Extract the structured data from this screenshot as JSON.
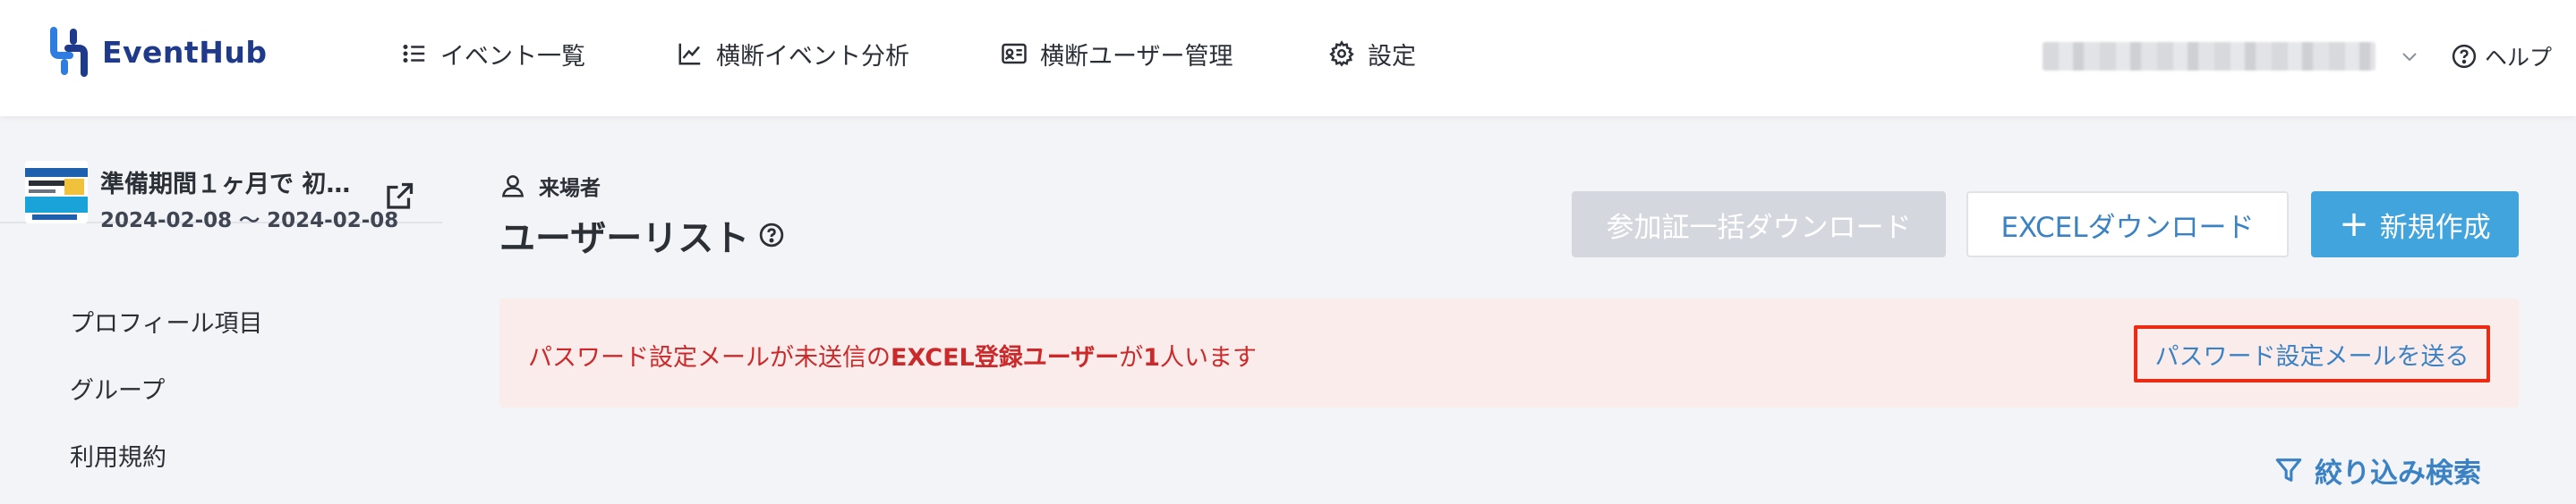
{
  "app": {
    "name": "EventHub",
    "brand_color": "#1f3a8a",
    "accent_color": "#42a4dd"
  },
  "header": {
    "nav": [
      {
        "label": "イベント一覧",
        "icon": "list-icon"
      },
      {
        "label": "横断イベント分析",
        "icon": "chart-line-icon"
      },
      {
        "label": "横断ユーザー管理",
        "icon": "id-card-icon"
      },
      {
        "label": "設定",
        "icon": "gear-icon"
      }
    ],
    "help_label": "ヘルプ"
  },
  "sidebar": {
    "event": {
      "title": "準備期間１ヶ月で 初…",
      "date_range": "2024-02-08 〜 2024-02-08"
    },
    "items": [
      {
        "label": "プロフィール項目"
      },
      {
        "label": "グループ"
      },
      {
        "label": "利用規約"
      }
    ]
  },
  "main": {
    "section_label": "来場者",
    "page_title": "ユーザーリスト",
    "buttons": {
      "bulk_download": "参加証一括ダウンロード",
      "excel_download": "EXCELダウンロード",
      "create_new": "新規作成",
      "create_plus": "+"
    },
    "alert": {
      "prefix": "パスワード設定メールが未送信の",
      "emphasis": "EXCEL登録ユーザー",
      "middle": "が",
      "count": "1",
      "suffix": "人います",
      "action": "パスワード設定メールを送る",
      "text_color": "#cc2a2a",
      "bg_color": "#fbecec",
      "highlight_color": "#ec2b14"
    },
    "filter_label": "絞り込み検索"
  }
}
